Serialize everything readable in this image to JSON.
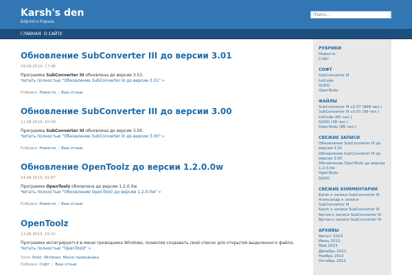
{
  "header": {
    "title": "Karsh's den",
    "description": "Берлога Карша",
    "search_placeholder": "Поиск..."
  },
  "nav": {
    "items": [
      "ГЛАВНАЯ",
      "О САЙТЕ"
    ],
    "separator": "|"
  },
  "posts": [
    {
      "title": "Обновление SubConverter III до версии 3.01",
      "date": "19.08.2014, 17:48",
      "text_bold": "SubConverter III",
      "text_pre": "Программа ",
      "text_post": " обновлена до версии 3.01.",
      "more": "Читать полностью \"Обновление SubConverter III до версии 3.01\" »",
      "meta_label": "Рубрика: ",
      "category": "Новости",
      "sep": "|",
      "comments": "Ваш отзыв"
    },
    {
      "title": "Обновление SubConverter III до версии 3.00",
      "date": "11.08.2014, 10:09",
      "text_bold": "SubConverter III",
      "text_pre": "Программа ",
      "text_post": " обновлена до версии 3.00.",
      "more": "Читать полностью \"Обновление SubConverter III до версии 3.00\" »",
      "meta_label": "Рубрика: ",
      "category": "Новости",
      "sep": "|",
      "comments": "Ваш отзыв"
    },
    {
      "title": "Обновление OpenToolz до версии 1.2.0.0w",
      "date": "14.06.2013, 02:07",
      "text_bold": "OpenToolz",
      "text_pre": "Программа ",
      "text_post": " обновлена до версии 1.2.0.0w.",
      "more": "Читать полностью \"Обновление OpenToolz до версии 1.2.0.0w\" »",
      "meta_label": "Рубрика: ",
      "category": "Новости",
      "sep": "|",
      "comments": "Ваш отзыв"
    },
    {
      "title": "OpenToolz",
      "date": "13.06.2013, 18:22",
      "text": "Программа интегрируется в меню проводника Windows, позволяя создавать свой список для открытия выделенного файла.",
      "more": "Читать полностью \"OpenToolz\" »",
      "tags_label": "Теги: ",
      "tags": [
        "Shell",
        "Windows",
        "Меню проводника"
      ],
      "meta_label": "Рубрика: ",
      "category": "Софт",
      "sep": "|",
      "comments": "Ваш отзыв"
    }
  ],
  "sidebar": {
    "sections": [
      {
        "title": "РУБРИКИ",
        "items": [
          "Новости",
          "Софт"
        ]
      },
      {
        "title": "СОФТ",
        "items": [
          "SubConverter III",
          "txtCode",
          "SUDO",
          "OpenToolz"
        ]
      },
      {
        "title": "ФАЙЛЫ",
        "items": [
          "SubConverter III v2.07 (966 чел.)",
          "SubConverter III v3.01 (99 чел.)",
          "txtCode (85 чел.)",
          "SUDO (38 чел.)",
          "OpenToolz (86 чел.)"
        ]
      },
      {
        "title": "СВЕЖИЕ ЗАПИСИ",
        "items": [
          "Обновление SubConverter III до",
          "версии 3.01",
          "Обновление SubConverter III до",
          "версии 3.00",
          "Обновление OpenToolz до версии",
          "1.2.0.0w",
          "OpenToolz",
          "SUDO"
        ]
      },
      {
        "title": "СВЕЖИЕ КОММЕНТАРИИ",
        "items": [
          "Karsh к записи SubConverter III",
          "Александр к записи",
          "SubConverter III",
          "Karsh к записи SubConverter III",
          "Артем к записи SubConverter III",
          "Артем к записи SubConverter III"
        ]
      },
      {
        "title": "АРХИВЫ",
        "items": [
          "Август 2014",
          "Июнь 2013",
          "Май 2013",
          "Декабрь 2012",
          "Ноябрь 2012",
          "Октябрь 2012"
        ]
      }
    ]
  },
  "colors": {
    "header_bg": "#3277b3",
    "nav_bg": "#1d4e7d",
    "link": "#1e6ba8",
    "sidebar_bg": "#e8e8e8"
  }
}
